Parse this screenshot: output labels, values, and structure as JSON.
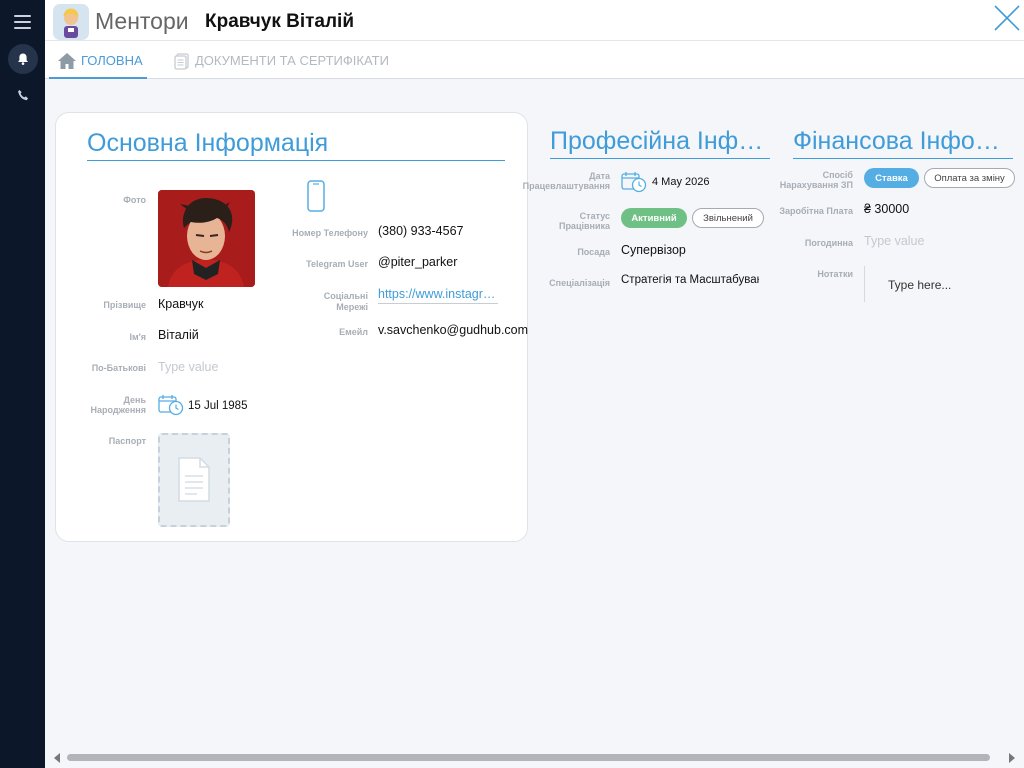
{
  "header": {
    "app_name": "Ментори",
    "item_title": "Кравчук Віталій"
  },
  "tabs": [
    {
      "label": "ГОЛОВНА",
      "active": true,
      "icon": "home-icon"
    },
    {
      "label": "ДОКУМЕНТИ ТА СЕРТИФІКАТИ",
      "active": false,
      "icon": "document-icon"
    }
  ],
  "basic": {
    "title": "Основна Інформація",
    "photo_label": "Фото",
    "last_name_label": "Прізвище",
    "last_name": "Кравчук",
    "first_name_label": "Ім'я",
    "first_name": "Віталій",
    "patronymic_label": "По-Батькові",
    "patronymic_placeholder": "Type value",
    "birthday_label_1": "День",
    "birthday_label_2": "Народження",
    "birthday": "15 Jul 1985",
    "passport_label": "Паспорт",
    "phone_label": "Номер Телефону",
    "phone": "(380) 933-4567",
    "telegram_label": "Telegram User",
    "telegram": "@piter_parker",
    "social_label_1": "Соціальні",
    "social_label_2": "Мережі",
    "social": "https://www.instagram.com/",
    "email_label": "Емейл",
    "email": "v.savchenko@gudhub.com"
  },
  "professional": {
    "title": "Професійна Інформація",
    "hire_date_label_1": "Дата",
    "hire_date_label_2": "Працевлаштування",
    "hire_date": "4 May 2026",
    "status_label_1": "Статус",
    "status_label_2": "Працівника",
    "status_active": "Активний",
    "status_fired": "Звільнений",
    "position_label": "Посада",
    "position": "Супервізор",
    "specialization_label": "Спеціалізація",
    "specialization": "Стратегія та Масштабування"
  },
  "financial": {
    "title": "Фінансова Інформація",
    "pay_method_label_1": "Спосіб",
    "pay_method_label_2": "Нарахування ЗП",
    "pay_rate": "Ставка",
    "pay_shift": "Оплата за зміну",
    "salary_label": "Заробітна Плата",
    "salary": "₴ 30000",
    "hourly_label": "Погодинна",
    "hourly_placeholder": "Type value",
    "notes_label": "Нотатки",
    "notes_placeholder": "Type here..."
  },
  "colors": {
    "accent": "#3f9cd9",
    "sidebar": "#0c1829",
    "active_green": "#6fc085",
    "active_blue": "#55aee3"
  }
}
